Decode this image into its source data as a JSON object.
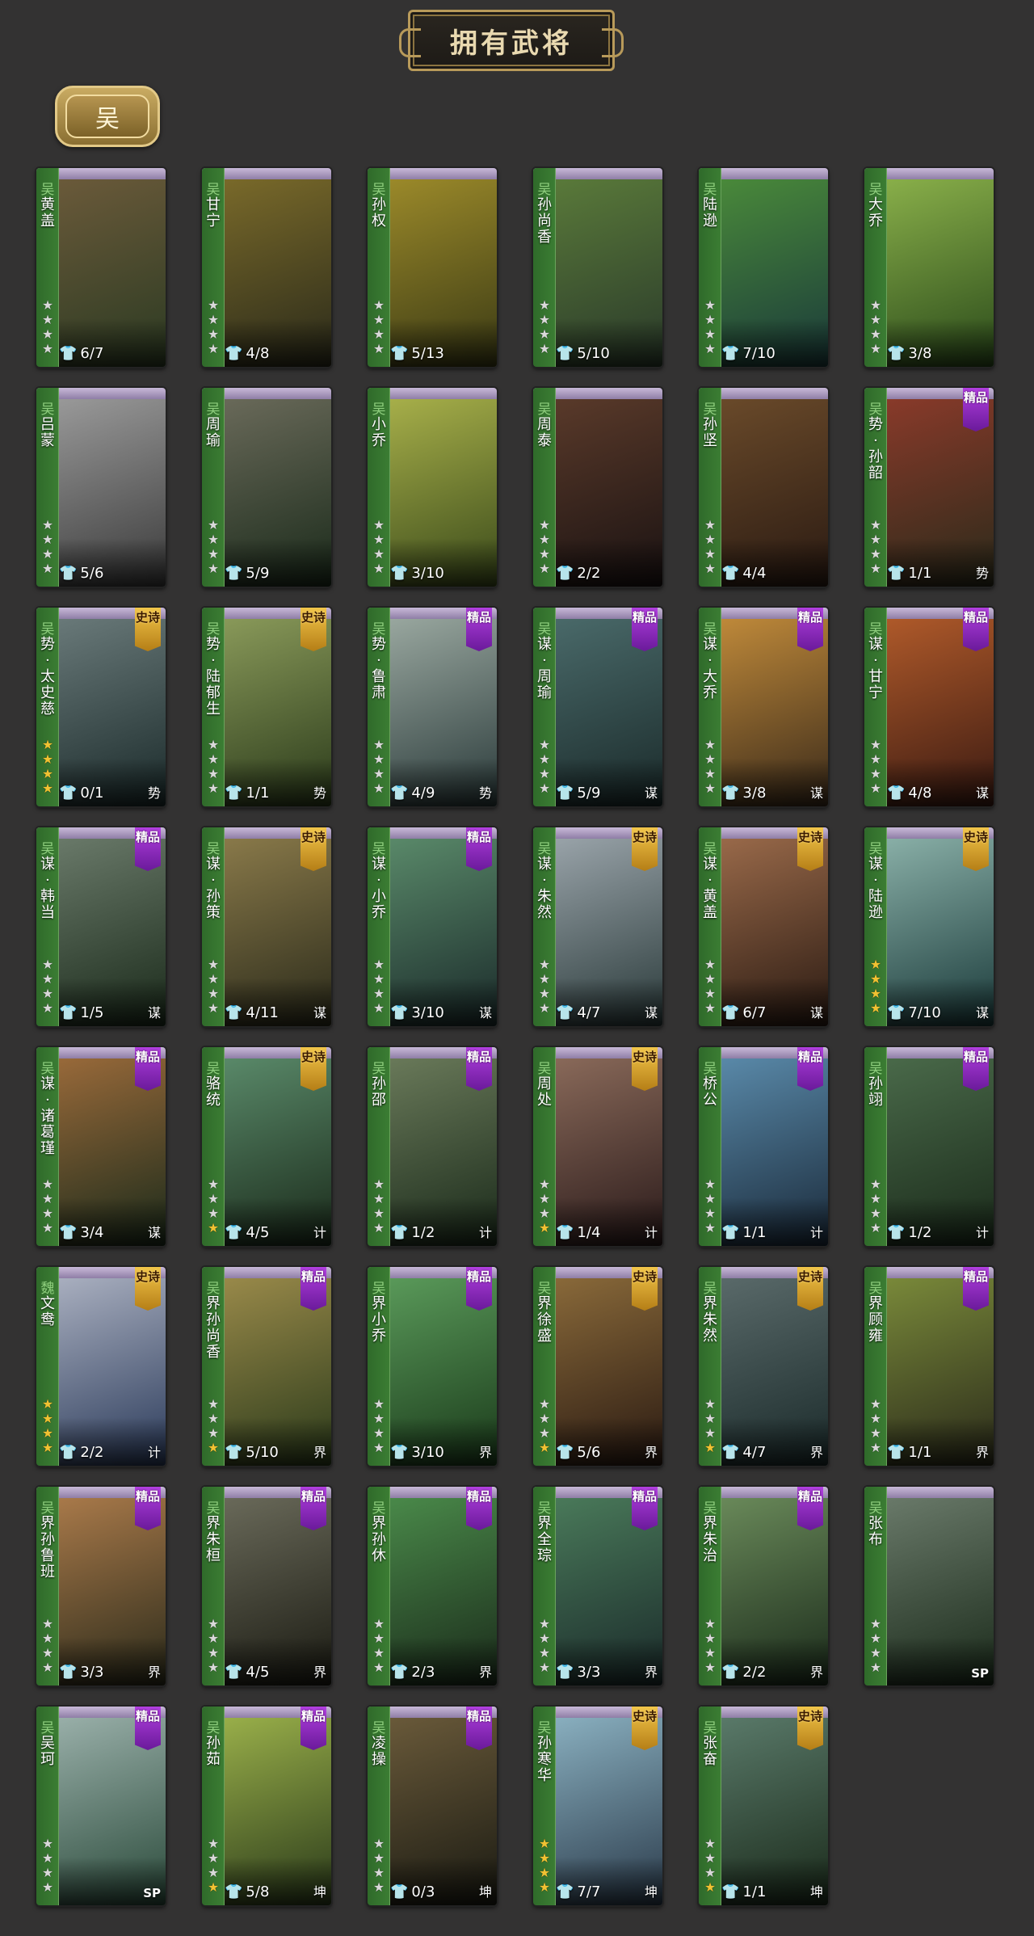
{
  "header": {
    "title": "拥有武将"
  },
  "filter": {
    "kingdom_label": "吴"
  },
  "colors": {
    "gold": "#f1c232",
    "jingpin": "#8e2bc4",
    "shishi": "#d9a12c",
    "strip": "#2f6a2a"
  },
  "generals": [
    {
      "name": "黄盖",
      "faction": "吴",
      "stars": "4",
      "gold_stars": "0",
      "skins": "6/7",
      "skin_icon": "white",
      "badge": "",
      "tag": "",
      "art": [
        "#6b5a3a",
        "#2b3a22"
      ]
    },
    {
      "name": "甘宁",
      "faction": "吴",
      "stars": "4",
      "gold_stars": "0",
      "skins": "4/8",
      "skin_icon": "white",
      "badge": "",
      "tag": "",
      "art": [
        "#7a6a2a",
        "#2a2a1a"
      ]
    },
    {
      "name": "孙权",
      "faction": "吴",
      "stars": "4",
      "gold_stars": "0",
      "skins": "5/13",
      "skin_icon": "white",
      "badge": "",
      "tag": "",
      "art": [
        "#9c8a2a",
        "#3a3a14"
      ]
    },
    {
      "name": "孙尚香",
      "faction": "吴",
      "stars": "4",
      "gold_stars": "0",
      "skins": "5/10",
      "skin_icon": "white",
      "badge": "",
      "tag": "",
      "art": [
        "#5a7a3a",
        "#2a3a2a"
      ]
    },
    {
      "name": "陆逊",
      "faction": "吴",
      "stars": "4",
      "gold_stars": "0",
      "skins": "7/10",
      "skin_icon": "white",
      "badge": "",
      "tag": "",
      "art": [
        "#4a8a3a",
        "#1a3a3a"
      ]
    },
    {
      "name": "大乔",
      "faction": "吴",
      "stars": "4",
      "gold_stars": "0",
      "skins": "3/8",
      "skin_icon": "white",
      "badge": "",
      "tag": "",
      "art": [
        "#8ab04a",
        "#2a4a1a"
      ]
    },
    {
      "name": "吕蒙",
      "faction": "吴",
      "stars": "4",
      "gold_stars": "0",
      "skins": "5/6",
      "skin_icon": "white",
      "badge": "",
      "tag": "",
      "art": [
        "#9a9a9a",
        "#3a3a3a"
      ]
    },
    {
      "name": "周瑜",
      "faction": "吴",
      "stars": "4",
      "gold_stars": "0",
      "skins": "5/9",
      "skin_icon": "white",
      "badge": "",
      "tag": "",
      "art": [
        "#6a6a5a",
        "#1a2a1a"
      ]
    },
    {
      "name": "小乔",
      "faction": "吴",
      "stars": "4",
      "gold_stars": "0",
      "skins": "3/10",
      "skin_icon": "white",
      "badge": "",
      "tag": "",
      "art": [
        "#a8b04a",
        "#3a4a1a"
      ]
    },
    {
      "name": "周泰",
      "faction": "吴",
      "stars": "4",
      "gold_stars": "0",
      "skins": "2/2",
      "skin_icon": "gold",
      "badge": "",
      "tag": "",
      "art": [
        "#5a3a2a",
        "#1a1212"
      ]
    },
    {
      "name": "孙坚",
      "faction": "吴",
      "stars": "4",
      "gold_stars": "0",
      "skins": "4/4",
      "skin_icon": "gold",
      "badge": "",
      "tag": "",
      "art": [
        "#6a4a2a",
        "#2a1a12"
      ]
    },
    {
      "name": "势·孙韶",
      "faction": "吴",
      "stars": "4",
      "gold_stars": "0",
      "skins": "1/1",
      "skin_icon": "gold",
      "badge": "精品",
      "tag": "势",
      "art": [
        "#8a3a2a",
        "#2a2a1a"
      ]
    },
    {
      "name": "势·太史慈",
      "faction": "吴",
      "stars": "4",
      "gold_stars": "4",
      "skins": "0/1",
      "skin_icon": "white",
      "badge": "史诗",
      "tag": "势",
      "art": [
        "#6a7a7a",
        "#1a2a2a"
      ]
    },
    {
      "name": "势·陆郁生",
      "faction": "吴",
      "stars": "4",
      "gold_stars": "0",
      "skins": "1/1",
      "skin_icon": "gold",
      "badge": "史诗",
      "tag": "势",
      "art": [
        "#8a9a5a",
        "#2a3a1a"
      ]
    },
    {
      "name": "势·鲁肃",
      "faction": "吴",
      "stars": "4",
      "gold_stars": "0",
      "skins": "4/9",
      "skin_icon": "white",
      "badge": "精品",
      "tag": "势",
      "art": [
        "#9aa8a0",
        "#2a3a3a"
      ]
    },
    {
      "name": "谋·周瑜",
      "faction": "吴",
      "stars": "4",
      "gold_stars": "0",
      "skins": "5/9",
      "skin_icon": "white",
      "badge": "精品",
      "tag": "谋",
      "art": [
        "#4a6a6a",
        "#1a2a2a"
      ]
    },
    {
      "name": "谋·大乔",
      "faction": "吴",
      "stars": "4",
      "gold_stars": "0",
      "skins": "3/8",
      "skin_icon": "white",
      "badge": "精品",
      "tag": "谋",
      "art": [
        "#c08a3a",
        "#3a2a1a"
      ]
    },
    {
      "name": "谋·甘宁",
      "faction": "吴",
      "stars": "4",
      "gold_stars": "0",
      "skins": "4/8",
      "skin_icon": "white",
      "badge": "精品",
      "tag": "谋",
      "art": [
        "#b05a2a",
        "#3a1a12"
      ]
    },
    {
      "name": "谋·韩当",
      "faction": "吴",
      "stars": "4",
      "gold_stars": "0",
      "skins": "1/5",
      "skin_icon": "white",
      "badge": "精品",
      "tag": "谋",
      "art": [
        "#6a7a6a",
        "#1a2a1a"
      ]
    },
    {
      "name": "谋·孙策",
      "faction": "吴",
      "stars": "4",
      "gold_stars": "0",
      "skins": "4/11",
      "skin_icon": "white",
      "badge": "史诗",
      "tag": "谋",
      "art": [
        "#8a7a4a",
        "#2a2a1a"
      ]
    },
    {
      "name": "谋·小乔",
      "faction": "吴",
      "stars": "4",
      "gold_stars": "0",
      "skins": "3/10",
      "skin_icon": "white",
      "badge": "精品",
      "tag": "谋",
      "art": [
        "#5a8a6a",
        "#1a2a2a"
      ]
    },
    {
      "name": "谋·朱然",
      "faction": "吴",
      "stars": "4",
      "gold_stars": "0",
      "skins": "4/7",
      "skin_icon": "white",
      "badge": "史诗",
      "tag": "谋",
      "art": [
        "#9aa4aa",
        "#2a3a3a"
      ]
    },
    {
      "name": "谋·黄盖",
      "faction": "吴",
      "stars": "4",
      "gold_stars": "0",
      "skins": "6/7",
      "skin_icon": "white",
      "badge": "史诗",
      "tag": "谋",
      "art": [
        "#9a6a4a",
        "#2a1a12"
      ]
    },
    {
      "name": "谋·陆逊",
      "faction": "吴",
      "stars": "4",
      "gold_stars": "4",
      "skins": "7/10",
      "skin_icon": "white",
      "badge": "史诗",
      "tag": "谋",
      "art": [
        "#8ab0a8",
        "#1a3a3a"
      ]
    },
    {
      "name": "谋·诸葛瑾",
      "faction": "吴",
      "stars": "4",
      "gold_stars": "0",
      "skins": "3/4",
      "skin_icon": "white",
      "badge": "精品",
      "tag": "谋",
      "art": [
        "#9a6a3a",
        "#1a2a1a"
      ]
    },
    {
      "name": "骆统",
      "faction": "吴",
      "stars": "4",
      "gold_stars": "1",
      "skins": "4/5",
      "skin_icon": "white",
      "badge": "史诗",
      "tag": "计",
      "art": [
        "#5a8a6a",
        "#1a2a1a"
      ]
    },
    {
      "name": "孙邵",
      "faction": "吴",
      "stars": "4",
      "gold_stars": "0",
      "skins": "1/2",
      "skin_icon": "white",
      "badge": "精品",
      "tag": "计",
      "art": [
        "#6a7a5a",
        "#1a2a1a"
      ]
    },
    {
      "name": "周处",
      "faction": "吴",
      "stars": "4",
      "gold_stars": "1",
      "skins": "1/4",
      "skin_icon": "white",
      "badge": "史诗",
      "tag": "计",
      "art": [
        "#8a6a5a",
        "#2a1a1a"
      ]
    },
    {
      "name": "桥公",
      "faction": "吴",
      "stars": "4",
      "gold_stars": "0",
      "skins": "1/1",
      "skin_icon": "gold",
      "badge": "精品",
      "tag": "计",
      "art": [
        "#5a8aaa",
        "#1a2a3a"
      ]
    },
    {
      "name": "孙翊",
      "faction": "吴",
      "stars": "4",
      "gold_stars": "0",
      "skins": "1/2",
      "skin_icon": "white",
      "badge": "精品",
      "tag": "计",
      "art": [
        "#4a6a4a",
        "#1a2a1a"
      ]
    },
    {
      "name": "文鸯",
      "faction": "魏",
      "stars": "4",
      "gold_stars": "4",
      "skins": "2/2",
      "skin_icon": "gold",
      "badge": "史诗",
      "tag": "计",
      "art": [
        "#aab0c0",
        "#2a3a5a"
      ]
    },
    {
      "name": "界孙尚香",
      "faction": "吴",
      "stars": "4",
      "gold_stars": "1",
      "skins": "5/10",
      "skin_icon": "white",
      "badge": "精品",
      "tag": "界",
      "art": [
        "#9a8a4a",
        "#2a3a1a"
      ]
    },
    {
      "name": "界小乔",
      "faction": "吴",
      "stars": "4",
      "gold_stars": "0",
      "skins": "3/10",
      "skin_icon": "white",
      "badge": "精品",
      "tag": "界",
      "art": [
        "#5a9a5a",
        "#1a3a1a"
      ]
    },
    {
      "name": "界徐盛",
      "faction": "吴",
      "stars": "4",
      "gold_stars": "1",
      "skins": "5/6",
      "skin_icon": "white",
      "badge": "史诗",
      "tag": "界",
      "art": [
        "#8a6a3a",
        "#2a1a12"
      ]
    },
    {
      "name": "界朱然",
      "faction": "吴",
      "stars": "4",
      "gold_stars": "1",
      "skins": "4/7",
      "skin_icon": "white",
      "badge": "史诗",
      "tag": "界",
      "art": [
        "#5a6a6a",
        "#1a2a2a"
      ]
    },
    {
      "name": "界顾雍",
      "faction": "吴",
      "stars": "4",
      "gold_stars": "0",
      "skins": "1/1",
      "skin_icon": "gold",
      "badge": "精品",
      "tag": "界",
      "art": [
        "#7a8a3a",
        "#2a2a1a"
      ]
    },
    {
      "name": "界孙鲁班",
      "faction": "吴",
      "stars": "4",
      "gold_stars": "0",
      "skins": "3/3",
      "skin_icon": "gold",
      "badge": "精品",
      "tag": "界",
      "art": [
        "#aa7a4a",
        "#2a2a1a"
      ]
    },
    {
      "name": "界朱桓",
      "faction": "吴",
      "stars": "4",
      "gold_stars": "0",
      "skins": "4/5",
      "skin_icon": "white",
      "badge": "精品",
      "tag": "界",
      "art": [
        "#6a6a5a",
        "#1a1a12"
      ]
    },
    {
      "name": "界孙休",
      "faction": "吴",
      "stars": "4",
      "gold_stars": "0",
      "skins": "2/3",
      "skin_icon": "white",
      "badge": "精品",
      "tag": "界",
      "art": [
        "#4a8a4a",
        "#1a2a1a"
      ]
    },
    {
      "name": "界全琮",
      "faction": "吴",
      "stars": "4",
      "gold_stars": "0",
      "skins": "3/3",
      "skin_icon": "gold",
      "badge": "精品",
      "tag": "界",
      "art": [
        "#4a7a5a",
        "#1a2a2a"
      ]
    },
    {
      "name": "界朱治",
      "faction": "吴",
      "stars": "4",
      "gold_stars": "0",
      "skins": "2/2",
      "skin_icon": "gold",
      "badge": "精品",
      "tag": "界",
      "art": [
        "#6a8a5a",
        "#1a2a1a"
      ]
    },
    {
      "name": "张布",
      "faction": "吴",
      "stars": "4",
      "gold_stars": "0",
      "skins": "",
      "skin_icon": "",
      "badge": "",
      "tag": "SP",
      "art": [
        "#6a7a6a",
        "#1a2a1a"
      ]
    },
    {
      "name": "吴珂",
      "faction": "吴",
      "stars": "4",
      "gold_stars": "0",
      "skins": "",
      "skin_icon": "",
      "badge": "精品",
      "tag": "SP",
      "art": [
        "#9ab0aa",
        "#2a4a3a"
      ]
    },
    {
      "name": "孙茹",
      "faction": "吴",
      "stars": "4",
      "gold_stars": "1",
      "skins": "5/8",
      "skin_icon": "white",
      "badge": "精品",
      "tag": "坤",
      "art": [
        "#9ab04a",
        "#2a3a1a"
      ]
    },
    {
      "name": "凌操",
      "faction": "吴",
      "stars": "4",
      "gold_stars": "0",
      "skins": "0/3",
      "skin_icon": "white",
      "badge": "精品",
      "tag": "坤",
      "art": [
        "#6a5a3a",
        "#1a1a12"
      ]
    },
    {
      "name": "孙寒华",
      "faction": "吴",
      "stars": "4",
      "gold_stars": "4",
      "skins": "7/7",
      "skin_icon": "gold",
      "badge": "史诗",
      "tag": "坤",
      "art": [
        "#8ab0c0",
        "#2a3a4a"
      ]
    },
    {
      "name": "张奋",
      "faction": "吴",
      "stars": "4",
      "gold_stars": "1",
      "skins": "1/1",
      "skin_icon": "gold",
      "badge": "史诗",
      "tag": "坤",
      "art": [
        "#5a7a6a",
        "#1a2a1a"
      ]
    }
  ]
}
